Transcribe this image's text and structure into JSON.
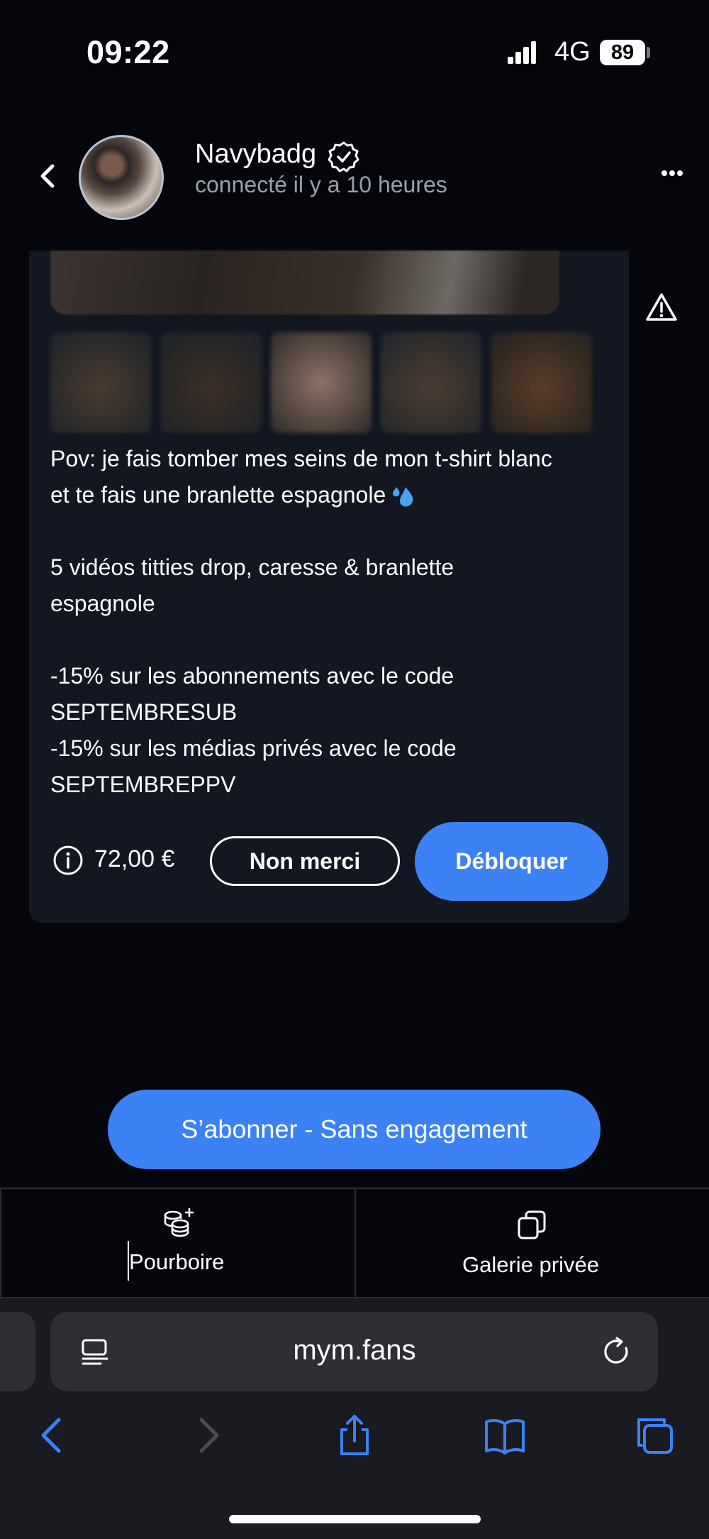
{
  "status_bar": {
    "time": "09:22",
    "network": "4G",
    "battery": "89"
  },
  "header": {
    "name": "Navybadg",
    "status": "connecté il y a 10 heures",
    "icons": [
      "back-icon",
      "verified-badge-icon",
      "more-icon"
    ]
  },
  "message": {
    "lines": [
      "Pov: je fais tomber mes seins de mon t-shirt blanc",
      "et te fais une branlette espagnole",
      "5 vidéos titties drop, caresse & branlette",
      "espagnole",
      "-15% sur les abonnements avec le code",
      "SEPTEMBRESUB",
      "-15% sur les médias privés avec le code",
      "SEPTEMBREPPV"
    ],
    "emoji": "💦",
    "price": "72,00 €",
    "decline_label": "Non merci",
    "unlock_label": "Débloquer"
  },
  "subscribe_label": "S’abonner - Sans engagement",
  "tabs": [
    {
      "label": "Pourboire",
      "icon": "coins-plus-icon"
    },
    {
      "label": "Galerie privée",
      "icon": "gallery-icon"
    }
  ],
  "browser": {
    "url": "mym.fans",
    "icons": [
      "reader-icon",
      "reload-icon",
      "back-arrow-icon",
      "forward-arrow-icon",
      "share-icon",
      "bookmarks-icon",
      "tabs-icon"
    ]
  },
  "colors": {
    "accent": "#3d82f5",
    "background": "#04060c",
    "card": "#121722"
  }
}
